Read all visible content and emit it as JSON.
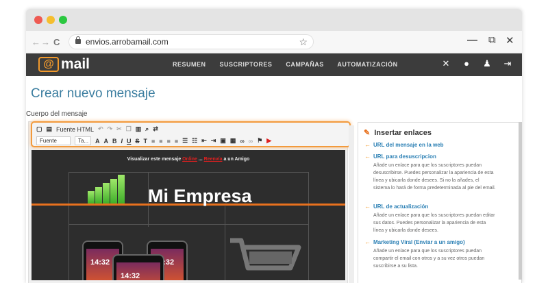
{
  "browser": {
    "url": "envios.arrobamail.com",
    "back": "←",
    "forward": "→",
    "reload": "C",
    "star": "☆",
    "minimize": "—",
    "restore": "⧉",
    "close": "✕"
  },
  "app": {
    "logo_at": "@",
    "logo_text": "mail",
    "menu": [
      "RESUMEN",
      "SUSCRIPTORES",
      "CAMPAÑAS",
      "AUTOMATIZACIÓN"
    ],
    "icons": [
      "tools-icon",
      "user-icon",
      "users-icon",
      "logout-icon"
    ],
    "accent": "#f39a2c",
    "bar_color": "#3c3c3c"
  },
  "page": {
    "title": "Crear nuevo mensaje",
    "body_label": "Cuerpo del mensaje"
  },
  "editor": {
    "source_label": "Fuente HTML",
    "font_select": "Fuente",
    "size_select": "Ta...",
    "format_buttons": [
      "B",
      "I",
      "U",
      "S"
    ],
    "preview_text_before": "Visualizar este mensaje",
    "preview_link1": "Online",
    "preview_sep": "...",
    "preview_link2": "Reenvía",
    "preview_text_after": "a un Amigo",
    "brand_name": "Mi Empresa",
    "phone_time": "14:32"
  },
  "panel": {
    "title": "Insertar enlaces",
    "links": [
      {
        "label": "URL del mensaje en la web",
        "desc": ""
      },
      {
        "label": "URL para desuscripcion",
        "desc": "Añade un enlace para que los suscriptores puedan desuscribirse. Puedes personalizar la apariencia de esta línea y ubicarla donde desees. Si no la añades, el sistema lo hará de forma predeterminada al pie del email."
      },
      {
        "label": "URL de actualización",
        "desc": "Añade un enlace para que los suscriptores puedan editar sus datos. Puedes personalizar la apariencia de esta línea y ubicarla donde desees."
      },
      {
        "label": "Marketing Viral (Enviar a un amigo)",
        "desc": "Añade un enlace para que los suscriptores puedan compartir el email con otros y a su vez otros puedan suscribirse a su lista."
      }
    ]
  }
}
